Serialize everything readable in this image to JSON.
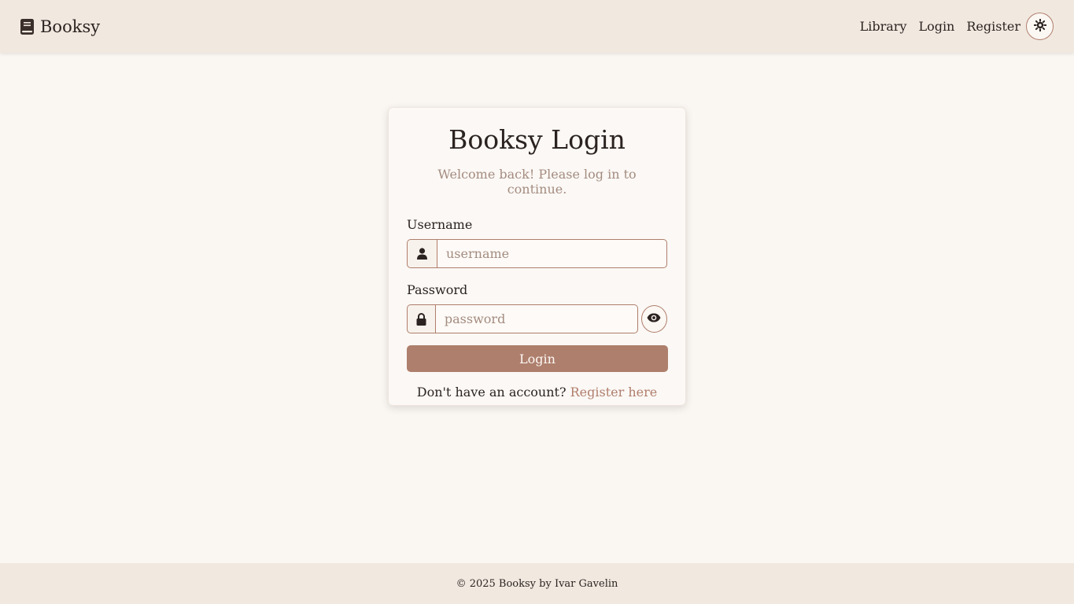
{
  "navbar": {
    "brand": "Booksy",
    "brand_icon": "book-icon",
    "links": [
      {
        "label": "Library"
      },
      {
        "label": "Login"
      },
      {
        "label": "Register"
      }
    ],
    "theme_icon": "sun-icon"
  },
  "login": {
    "title": "Booksy Login",
    "subtitle": "Welcome back! Please log in to continue.",
    "username_label": "Username",
    "username_placeholder": "username",
    "username_value": "",
    "username_icon": "user-icon",
    "password_label": "Password",
    "password_placeholder": "password",
    "password_value": "",
    "password_icon": "lock-icon",
    "show_password_icon": "eye-icon",
    "submit_label": "Login",
    "register_prompt": "Don't have an account?",
    "register_link": "Register here"
  },
  "footer": {
    "text": "© 2025 Booksy by Ivar Gavelin"
  },
  "colors": {
    "accent": "#ae7f6d",
    "navbar_bg": "#f1e9e0",
    "page_bg": "#faf6f2",
    "muted_text": "#a48c80"
  }
}
